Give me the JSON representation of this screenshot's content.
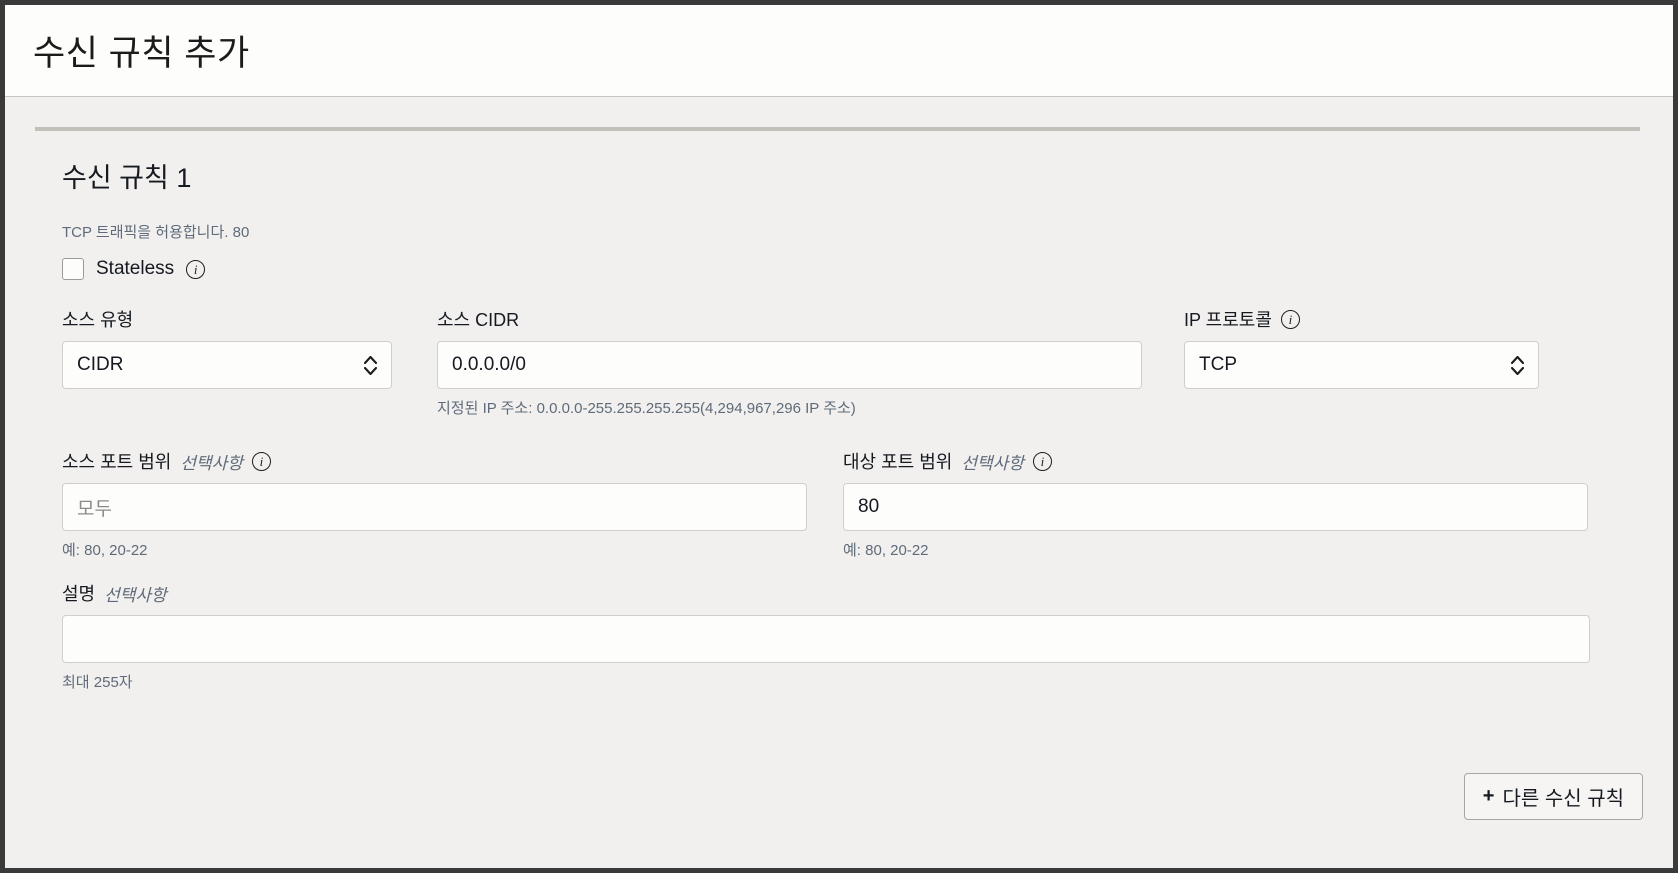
{
  "dialog": {
    "title": "수신 규칙 추가"
  },
  "rule": {
    "heading": "수신 규칙 1",
    "summary": "TCP 트래픽을 허용합니다. 80",
    "stateless": {
      "label": "Stateless",
      "checked": false,
      "info_icon": "info-icon"
    },
    "source_type": {
      "label": "소스 유형",
      "value": "CIDR",
      "options": [
        "CIDR"
      ]
    },
    "source_cidr": {
      "label": "소스 CIDR",
      "value": "0.0.0.0/0",
      "hint": "지정된 IP 주소: 0.0.0.0-255.255.255.255(4,294,967,296 IP 주소)"
    },
    "ip_protocol": {
      "label": "IP 프로토콜",
      "value": "TCP",
      "options": [
        "TCP"
      ],
      "info_icon": "info-icon"
    },
    "source_port_range": {
      "label": "소스 포트 범위",
      "optional": "선택사항",
      "placeholder": "모두",
      "value": "",
      "hint": "예: 80, 20-22",
      "info_icon": "info-icon"
    },
    "destination_port_range": {
      "label": "대상 포트 범위",
      "optional": "선택사항",
      "value": "80",
      "hint": "예: 80, 20-22",
      "info_icon": "info-icon"
    },
    "description": {
      "label": "설명",
      "optional": "선택사항",
      "value": "",
      "hint": "최대 255자"
    }
  },
  "footer": {
    "add_rule_label": "다른 수신 규칙",
    "plus": "+"
  }
}
